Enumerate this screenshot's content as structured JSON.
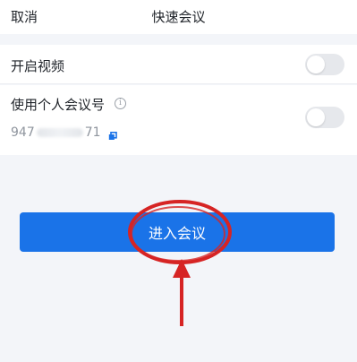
{
  "header": {
    "cancel_label": "取消",
    "title": "快速会议"
  },
  "settings": {
    "video": {
      "label": "开启视频",
      "enabled": false
    },
    "personal_meeting_id": {
      "label": "使用个人会议号",
      "info_icon": "info-icon",
      "number_prefix": "947",
      "number_suffix": "71",
      "enabled": false
    }
  },
  "action": {
    "enter_label": "进入会议",
    "color": "#1a73e8"
  },
  "annotation": {
    "color": "#d62424"
  }
}
